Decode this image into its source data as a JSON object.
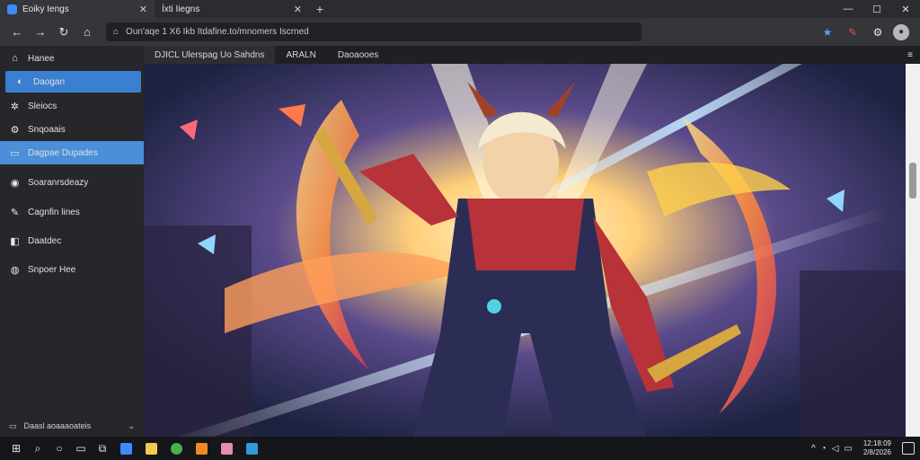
{
  "browser": {
    "tabs": [
      {
        "title": "Eoiky Iengs",
        "active": true
      },
      {
        "title": "Íxti Iiegns",
        "active": false
      }
    ],
    "new_tab_icon": "plus-icon",
    "window_controls": [
      "minimize-icon",
      "maximize-icon",
      "close-icon"
    ],
    "address": "Oun'aqe 1 X6 Ikb Itdafine.to/mnomers Iscrned",
    "toolbar_icons": [
      "star-icon",
      "extension-icon",
      "settings-icon",
      "avatar"
    ]
  },
  "sidebar": {
    "items": [
      {
        "label": "Hanee",
        "icon": "home-icon"
      },
      {
        "label": "Daogan",
        "icon": "discover-icon",
        "selected": true
      },
      {
        "label": "Sleiocs",
        "icon": "gear-icon"
      },
      {
        "label": "Snqoaais",
        "icon": "settings-icon"
      },
      {
        "label": "Dagpae Dupades",
        "icon": "folder-icon",
        "highlighted": true
      },
      {
        "label": "Soaranrsdeazy",
        "icon": "pin-icon"
      },
      {
        "label": "Cagnfin lines",
        "icon": "edit-icon"
      },
      {
        "label": "Daatdec",
        "icon": "window-icon"
      },
      {
        "label": "Snpoer Hee",
        "icon": "globe-icon"
      }
    ],
    "footer_label": "Daasl aoaaaoateis"
  },
  "content_tabs": [
    {
      "label": "DJICL Ulerspag Uo Sahdns",
      "active": true
    },
    {
      "label": "ARALN",
      "active": false
    },
    {
      "label": "Daoaooes",
      "active": false
    }
  ],
  "taskbar": {
    "clock_time": "12:18:09",
    "clock_date": "2/8/2026",
    "apps": [
      {
        "name": "explorer-icon",
        "color": "#3d8bfd"
      },
      {
        "name": "files-icon",
        "color": "#f2c94c"
      },
      {
        "name": "chrome-icon",
        "color": "#4caf50"
      },
      {
        "name": "app-orange-icon",
        "color": "#f08a24"
      },
      {
        "name": "app-pink-icon",
        "color": "#e88bb0"
      },
      {
        "name": "app-blue-icon",
        "color": "#2f9bd9"
      }
    ]
  },
  "colors": {
    "accent": "#3a7fd0",
    "sidebar": "#26272b",
    "chrome": "#35363a"
  }
}
